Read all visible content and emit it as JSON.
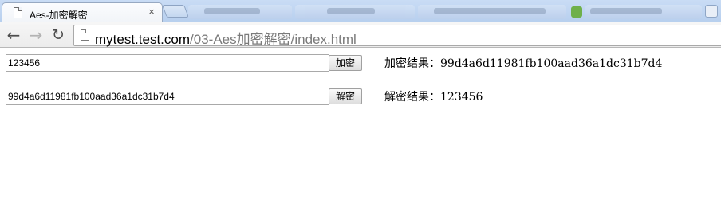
{
  "browser": {
    "tab": {
      "title": "Aes-加密解密",
      "close_glyph": "×",
      "icon": "document-icon"
    },
    "nav": {
      "back_glyph": "←",
      "forward_glyph": "→",
      "reload_glyph": "↻"
    },
    "address": {
      "host": "mytest.test.com",
      "path": "/03-Aes加密解密/index.html"
    }
  },
  "page": {
    "encrypt": {
      "input_value": "123456",
      "button_label": "加密",
      "result_label": "加密结果：",
      "result_value": "99d4a6d11981fb100aad36a1dc31b7d4"
    },
    "decrypt": {
      "input_value": "99d4a6d11981fb100aad36a1dc31b7d4",
      "button_label": "解密",
      "result_label": "解密结果：",
      "result_value": "123456"
    }
  }
}
